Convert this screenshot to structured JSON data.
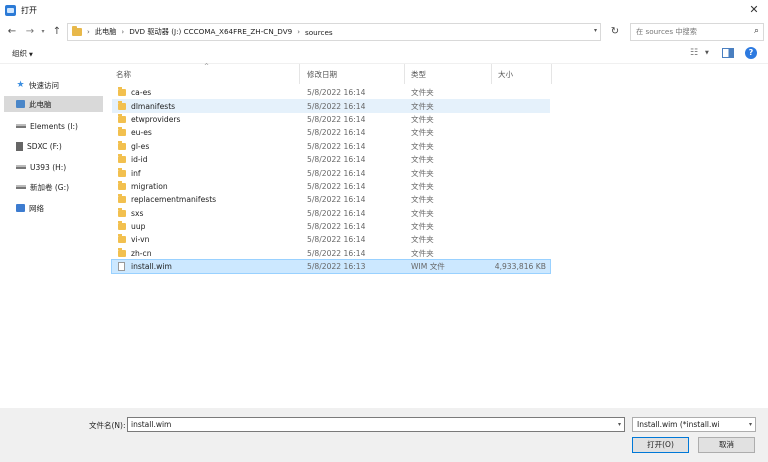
{
  "window": {
    "title": "打开"
  },
  "address": {
    "crumbs": [
      "此电脑",
      "DVD 驱动器 (J:) CCCOMA_X64FRE_ZH-CN_DV9",
      "sources"
    ],
    "search_placeholder": "在 sources 中搜索"
  },
  "toolbar": {
    "organize_label": "组织"
  },
  "nav": [
    {
      "label": "快速访问",
      "icon": "quick-access-star-icon"
    },
    {
      "label": "此电脑",
      "icon": "this-pc-icon",
      "selected": true
    },
    {
      "label": "Elements (I:)",
      "icon": "drive-icon"
    },
    {
      "label": "SDXC (F:)",
      "icon": "sd-card-icon"
    },
    {
      "label": "U393 (H:)",
      "icon": "drive-icon"
    },
    {
      "label": "新加卷 (G:)",
      "icon": "drive-icon"
    },
    {
      "label": "网络",
      "icon": "network-icon"
    }
  ],
  "columns": {
    "name": "名称",
    "date": "修改日期",
    "type": "类型",
    "size": "大小"
  },
  "files": [
    {
      "name": "ca-es",
      "date": "5/8/2022 16:14",
      "type": "文件夹",
      "size": "",
      "kind": "folder"
    },
    {
      "name": "dlmanifests",
      "date": "5/8/2022 16:14",
      "type": "文件夹",
      "size": "",
      "kind": "folder",
      "hover": true
    },
    {
      "name": "etwproviders",
      "date": "5/8/2022 16:14",
      "type": "文件夹",
      "size": "",
      "kind": "folder"
    },
    {
      "name": "eu-es",
      "date": "5/8/2022 16:14",
      "type": "文件夹",
      "size": "",
      "kind": "folder"
    },
    {
      "name": "gl-es",
      "date": "5/8/2022 16:14",
      "type": "文件夹",
      "size": "",
      "kind": "folder"
    },
    {
      "name": "id-id",
      "date": "5/8/2022 16:14",
      "type": "文件夹",
      "size": "",
      "kind": "folder"
    },
    {
      "name": "inf",
      "date": "5/8/2022 16:14",
      "type": "文件夹",
      "size": "",
      "kind": "folder"
    },
    {
      "name": "migration",
      "date": "5/8/2022 16:14",
      "type": "文件夹",
      "size": "",
      "kind": "folder"
    },
    {
      "name": "replacementmanifests",
      "date": "5/8/2022 16:14",
      "type": "文件夹",
      "size": "",
      "kind": "folder"
    },
    {
      "name": "sxs",
      "date": "5/8/2022 16:14",
      "type": "文件夹",
      "size": "",
      "kind": "folder"
    },
    {
      "name": "uup",
      "date": "5/8/2022 16:14",
      "type": "文件夹",
      "size": "",
      "kind": "folder"
    },
    {
      "name": "vi-vn",
      "date": "5/8/2022 16:14",
      "type": "文件夹",
      "size": "",
      "kind": "folder"
    },
    {
      "name": "zh-cn",
      "date": "5/8/2022 16:14",
      "type": "文件夹",
      "size": "",
      "kind": "folder"
    },
    {
      "name": "install.wim",
      "date": "5/8/2022 16:13",
      "type": "WIM 文件",
      "size": "4,933,816 KB",
      "kind": "file",
      "selected": true
    }
  ],
  "bottom": {
    "filename_label": "文件名(N):",
    "filename_value": "install.wim",
    "filetype_value": "Install.wim (*install.wi",
    "open_label": "打开(O)",
    "cancel_label": "取消"
  }
}
